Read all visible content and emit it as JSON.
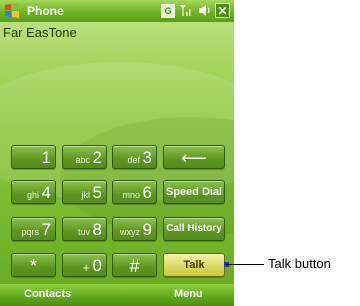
{
  "titlebar": {
    "title": "Phone",
    "status_g": "G",
    "close": "✕"
  },
  "screen": {
    "carrier": "Far EasTone"
  },
  "keypad": {
    "rows": [
      [
        {
          "digit": "1",
          "letters": ""
        },
        {
          "digit": "2",
          "letters": "abc"
        },
        {
          "digit": "3",
          "letters": "def"
        }
      ],
      [
        {
          "digit": "4",
          "letters": "ghi"
        },
        {
          "digit": "5",
          "letters": "jkl"
        },
        {
          "digit": "6",
          "letters": "mno"
        }
      ],
      [
        {
          "digit": "7",
          "letters": "pqrs"
        },
        {
          "digit": "8",
          "letters": "tuv"
        },
        {
          "digit": "9",
          "letters": "wxyz"
        }
      ],
      [
        {
          "digit": "*",
          "letters": ""
        },
        {
          "digit": "0",
          "letters": "+"
        },
        {
          "digit": "#",
          "letters": ""
        }
      ]
    ],
    "backspace": "⟵",
    "speed_dial": "Speed Dial",
    "call_history": "Call History",
    "talk": "Talk"
  },
  "softbar": {
    "left": "Contacts",
    "right": "Menu"
  },
  "callout": {
    "label": "Talk button"
  }
}
